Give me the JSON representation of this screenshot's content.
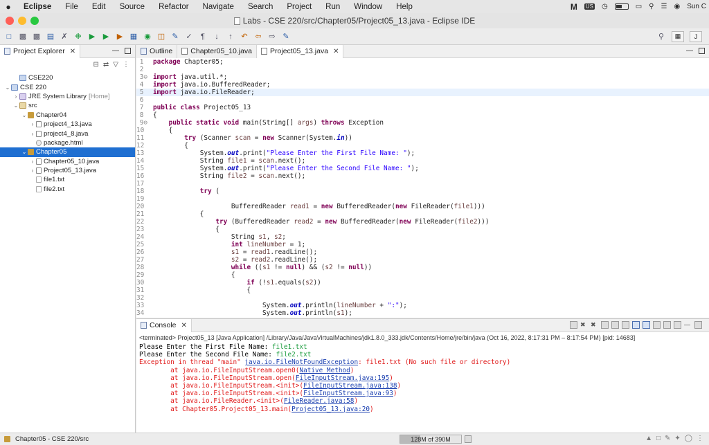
{
  "menubar": {
    "apple": "",
    "items": [
      "Eclipse",
      "File",
      "Edit",
      "Source",
      "Refactor",
      "Navigate",
      "Search",
      "Project",
      "Run",
      "Window",
      "Help"
    ],
    "status": {
      "m_icon": "M",
      "badge": "US",
      "clock_fragment": "Sun C"
    }
  },
  "window": {
    "title": "Labs - CSE 220/src/Chapter05/Project05_13.java - Eclipse IDE"
  },
  "explorer": {
    "tab_label": "Project Explorer",
    "close": "✕",
    "tree": [
      {
        "label": "CSE220",
        "indent": 1,
        "arrow": "",
        "icon": "project",
        "extra": ""
      },
      {
        "label": "CSE 220",
        "indent": 0,
        "arrow": "⌄",
        "icon": "project",
        "extra": ""
      },
      {
        "label": "JRE System Library",
        "indent": 1,
        "arrow": "›",
        "icon": "jre",
        "extra": "[Home]"
      },
      {
        "label": "src",
        "indent": 1,
        "arrow": "⌄",
        "icon": "src",
        "extra": ""
      },
      {
        "label": "Chapter04",
        "indent": 2,
        "arrow": "⌄",
        "icon": "pkg",
        "extra": ""
      },
      {
        "label": "project4_13.java",
        "indent": 3,
        "arrow": "›",
        "icon": "java",
        "extra": ""
      },
      {
        "label": "project4_8.java",
        "indent": 3,
        "arrow": "›",
        "icon": "java",
        "extra": ""
      },
      {
        "label": "package.html",
        "indent": 3,
        "arrow": "",
        "icon": "html",
        "extra": ""
      },
      {
        "label": "Chapter05",
        "indent": 2,
        "arrow": "⌄",
        "icon": "pkg",
        "extra": "",
        "selected": true
      },
      {
        "label": "Chapter05_10.java",
        "indent": 3,
        "arrow": "›",
        "icon": "java",
        "extra": ""
      },
      {
        "label": "Project05_13.java",
        "indent": 3,
        "arrow": "›",
        "icon": "java",
        "extra": ""
      },
      {
        "label": "file1.txt",
        "indent": 3,
        "arrow": "",
        "icon": "txt",
        "extra": ""
      },
      {
        "label": "file2.txt",
        "indent": 3,
        "arrow": "",
        "icon": "txt",
        "extra": ""
      }
    ]
  },
  "editor": {
    "tabs": [
      {
        "label": "Outline",
        "active": false,
        "close": ""
      },
      {
        "label": "Chapter05_10.java",
        "active": false,
        "close": ""
      },
      {
        "label": "Project05_13.java",
        "active": true,
        "close": "✕"
      }
    ],
    "highlighted_line": 5,
    "lines": [
      {
        "n": "1",
        "m": "",
        "html": "<span class=\"kw\">package</span> Chapter05;"
      },
      {
        "n": "2",
        "m": "",
        "html": ""
      },
      {
        "n": "3",
        "m": "⊖",
        "html": "<span class=\"kw\">import</span> java.util.*;"
      },
      {
        "n": "4",
        "m": "",
        "html": "<span class=\"kw\">import</span> java.io.BufferedReader;"
      },
      {
        "n": "5",
        "m": "",
        "html": "<span class=\"kw\">import</span> java.io.FileReader;"
      },
      {
        "n": "6",
        "m": "",
        "html": ""
      },
      {
        "n": "7",
        "m": "",
        "html": "<span class=\"kw\">public class</span> Project05_13"
      },
      {
        "n": "8",
        "m": "",
        "html": "{"
      },
      {
        "n": "9",
        "m": "⊖",
        "html": "    <span class=\"kw\">public static void</span> main(String[] <span class=\"param\">args</span>) <span class=\"kw\">throws</span> Exception"
      },
      {
        "n": "10",
        "m": "",
        "html": "    {"
      },
      {
        "n": "11",
        "m": "",
        "html": "        <span class=\"kw\">try</span> (Scanner <span class=\"param\">scan</span> = <span class=\"kw\">new</span> Scanner(System.<span class=\"fld\">in</span>))"
      },
      {
        "n": "12",
        "m": "",
        "html": "        {"
      },
      {
        "n": "13",
        "m": "",
        "html": "            System.<span class=\"fld\">out</span>.print(<span class=\"str\">\"Please Enter the First File Name: \"</span>);"
      },
      {
        "n": "14",
        "m": "",
        "html": "            String <span class=\"param\">file1</span> = <span class=\"param\">scan</span>.next();"
      },
      {
        "n": "15",
        "m": "",
        "html": "            System.<span class=\"fld\">out</span>.print(<span class=\"str\">\"Please Enter the Second File Name: \"</span>);"
      },
      {
        "n": "16",
        "m": "",
        "html": "            String <span class=\"param\">file2</span> = <span class=\"param\">scan</span>.next();"
      },
      {
        "n": "17",
        "m": "",
        "html": ""
      },
      {
        "n": "18",
        "m": "",
        "html": "            <span class=\"kw\">try</span> ("
      },
      {
        "n": "19",
        "m": "",
        "html": ""
      },
      {
        "n": "20",
        "m": "",
        "html": "                    BufferedReader <span class=\"param\">read1</span> = <span class=\"kw\">new</span> BufferedReader(<span class=\"kw\">new</span> FileReader(<span class=\"param\">file1</span>)))"
      },
      {
        "n": "21",
        "m": "",
        "html": "            {"
      },
      {
        "n": "22",
        "m": "",
        "html": "                <span class=\"kw\">try</span> (BufferedReader <span class=\"param\">read2</span> = <span class=\"kw\">new</span> BufferedReader(<span class=\"kw\">new</span> FileReader(<span class=\"param\">file2</span>)))"
      },
      {
        "n": "23",
        "m": "",
        "html": "                {"
      },
      {
        "n": "24",
        "m": "",
        "html": "                    String <span class=\"param\">s1</span>, <span class=\"param\">s2</span>;"
      },
      {
        "n": "25",
        "m": "",
        "html": "                    <span class=\"kw\">int</span> <span class=\"param\">lineNumber</span> = 1;"
      },
      {
        "n": "26",
        "m": "",
        "html": "                    <span class=\"param\">s1</span> = <span class=\"param\">read1</span>.readLine();"
      },
      {
        "n": "27",
        "m": "",
        "html": "                    <span class=\"param\">s2</span> = <span class=\"param\">read2</span>.readLine();"
      },
      {
        "n": "28",
        "m": "",
        "html": "                    <span class=\"kw\">while</span> ((<span class=\"param\">s1</span> != <span class=\"kw\">null</span>) &amp;&amp; (<span class=\"param\">s2</span> != <span class=\"kw\">null</span>))"
      },
      {
        "n": "29",
        "m": "",
        "html": "                    {"
      },
      {
        "n": "30",
        "m": "",
        "html": "                        <span class=\"kw\">if</span> (!<span class=\"param\">s1</span>.equals(<span class=\"param\">s2</span>))"
      },
      {
        "n": "31",
        "m": "",
        "html": "                        {"
      },
      {
        "n": "32",
        "m": "",
        "html": ""
      },
      {
        "n": "33",
        "m": "",
        "html": "                            System.<span class=\"fld\">out</span>.println(<span class=\"param\">lineNumber</span> + <span class=\"str\">\":\"</span>);"
      },
      {
        "n": "34",
        "m": "",
        "html": "                            System.<span class=\"fld\">out</span>.println(<span class=\"param\">s1</span>);"
      }
    ]
  },
  "console": {
    "tab_label": "Console",
    "close": "✕",
    "terminated": "<terminated> Project05_13 [Java Application] /Library/Java/JavaVirtualMachines/jdk1.8.0_333.jdk/Contents/Home/jre/bin/java  (Oct 16, 2022, 8:17:31 PM – 8:17:54 PM) [pid: 14683]",
    "output": [
      {
        "type": "prompt",
        "text": "Please Enter the First File Name: ",
        "input": "file1.txt"
      },
      {
        "type": "prompt",
        "text": "Please Enter the Second File Name: ",
        "input": "file2.txt"
      },
      {
        "type": "exception",
        "text": "Exception in thread \"main\" ",
        "link": "java.io.FileNotFoundException",
        "rest": ": file1.txt (No such file or directory)"
      },
      {
        "type": "trace",
        "text": "        at java.io.FileInputStream.open0(",
        "link": "Native Method",
        "rest": ")"
      },
      {
        "type": "trace",
        "text": "        at java.io.FileInputStream.open(",
        "link": "FileInputStream.java:195",
        "rest": ")"
      },
      {
        "type": "trace",
        "text": "        at java.io.FileInputStream.<init>(",
        "link": "FileInputStream.java:138",
        "rest": ")"
      },
      {
        "type": "trace",
        "text": "        at java.io.FileInputStream.<init>(",
        "link": "FileInputStream.java:93",
        "rest": ")"
      },
      {
        "type": "trace",
        "text": "        at java.io.FileReader.<init>(",
        "link": "FileReader.java:58",
        "rest": ")"
      },
      {
        "type": "trace",
        "text": "        at Chapter05.Project05_13.main(",
        "link": "Project05_13.java:20",
        "rest": ")"
      }
    ]
  },
  "statusbar": {
    "path": "Chapter05 - CSE 220/src",
    "heap": "128M of 390M",
    "heap_used_fraction": 0.33
  },
  "icons": {
    "toolbar": [
      "new-icon",
      "save-icon",
      "save-all-icon",
      "debug-icon",
      "run-icon",
      "coverage-icon",
      "external-tools-icon",
      "new-java-project-icon",
      "new-package-icon",
      "new-class-icon",
      "open-type-icon",
      "search-icon",
      "prev-annotation-icon",
      "next-annotation-icon",
      "back-icon",
      "forward-icon",
      "open-perspective-icon"
    ]
  }
}
